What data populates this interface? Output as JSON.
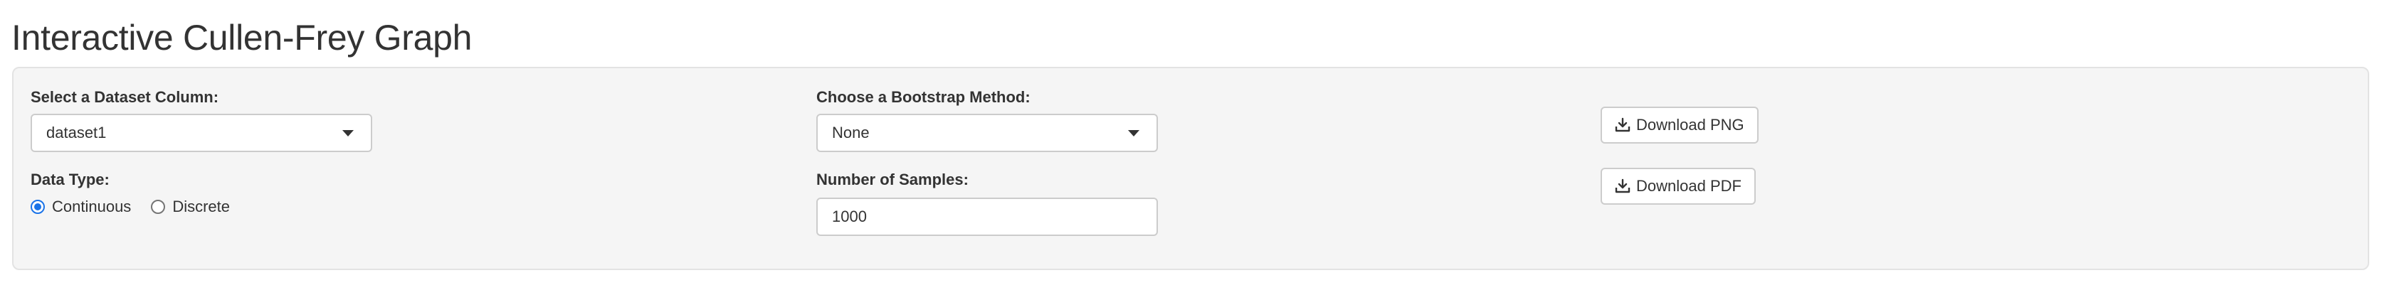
{
  "page": {
    "title": "Interactive Cullen-Frey Graph"
  },
  "dataset": {
    "label": "Select a Dataset Column:",
    "selected": "dataset1"
  },
  "data_type": {
    "label": "Data Type:",
    "options": [
      {
        "label": "Continuous",
        "checked": true
      },
      {
        "label": "Discrete",
        "checked": false
      }
    ]
  },
  "bootstrap": {
    "label": "Choose a Bootstrap Method:",
    "selected": "None"
  },
  "samples": {
    "label": "Number of Samples:",
    "value": "1000"
  },
  "downloads": {
    "png_label": "Download PNG",
    "pdf_label": "Download PDF",
    "icon": "download-icon"
  },
  "colors": {
    "accent": "#1a73e8",
    "panel_bg": "#f5f5f5",
    "border": "#cccccc",
    "text": "#333333"
  }
}
